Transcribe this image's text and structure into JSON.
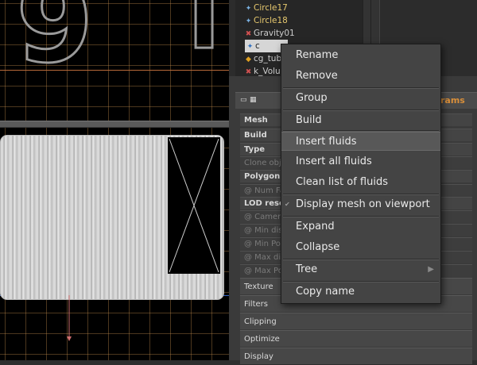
{
  "object_tree": {
    "items": [
      {
        "label": "Circle17",
        "icon": "point-icon",
        "yellow": true
      },
      {
        "label": "Circle18",
        "icon": "point-icon",
        "yellow": true
      },
      {
        "label": "Gravity01",
        "icon": "gravity-icon",
        "yellow": false
      },
      {
        "label": "c",
        "icon": "fluid-icon",
        "selected": true
      },
      {
        "label": "cg_tub",
        "icon": "tube-icon",
        "yellow": false
      },
      {
        "label": "k_Volur",
        "icon": "volume-icon",
        "yellow": false
      }
    ]
  },
  "panel": {
    "tab_label": "rams"
  },
  "attributes": [
    {
      "label": "Mesh",
      "style": "bold"
    },
    {
      "label": "Build",
      "style": "bold"
    },
    {
      "label": "Type",
      "style": "bold"
    },
    {
      "label": "Clone obj",
      "style": "dim"
    },
    {
      "label": "Polygon si",
      "style": "bold"
    },
    {
      "label": "@ Num Fa",
      "style": "dim"
    },
    {
      "label": "LOD resolu",
      "style": "bold"
    },
    {
      "label": "@ Camera",
      "style": "dim"
    },
    {
      "label": "@ Min dist",
      "style": "dim"
    },
    {
      "label": "@ Min Poly",
      "style": "dim"
    },
    {
      "label": "@ Max dis",
      "style": "dim"
    },
    {
      "label": "@ Max Po",
      "style": "dim"
    }
  ],
  "sections": [
    "Texture",
    "Filters",
    "Clipping",
    "Optimize",
    "Display"
  ],
  "context_menu": {
    "items": [
      "Rename",
      "Remove",
      "Group",
      "Build",
      "Insert fluids",
      "Insert all fluids",
      "Clean list of fluids",
      "Display mesh on viewport",
      "Expand",
      "Collapse",
      "Tree",
      "Copy name"
    ],
    "hovered": "Insert fluids",
    "tree_arrow": "▶",
    "display_check": "✔"
  }
}
